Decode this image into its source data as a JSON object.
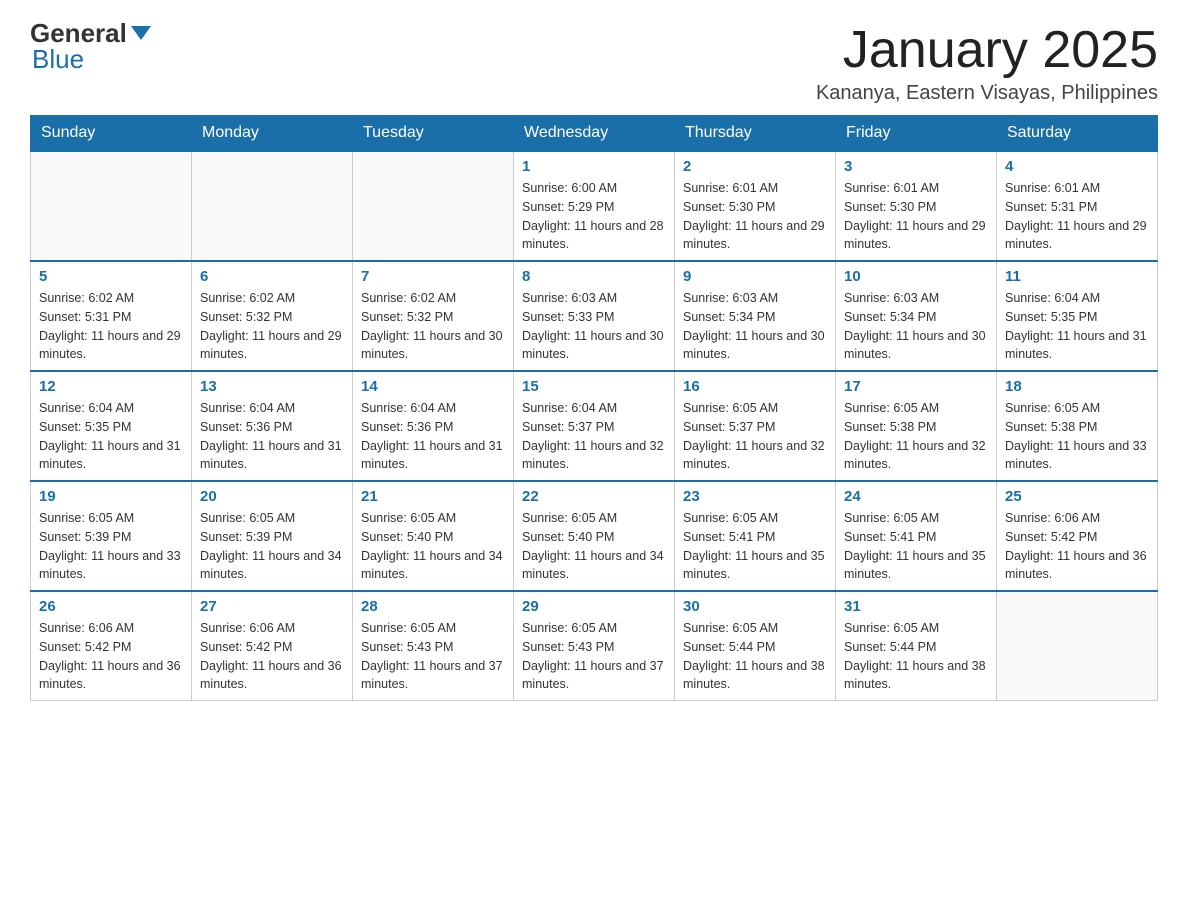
{
  "header": {
    "logo": {
      "general": "General",
      "blue": "Blue"
    },
    "title": "January 2025",
    "location": "Kananya, Eastern Visayas, Philippines"
  },
  "days_of_week": [
    "Sunday",
    "Monday",
    "Tuesday",
    "Wednesday",
    "Thursday",
    "Friday",
    "Saturday"
  ],
  "weeks": [
    [
      {
        "day": "",
        "info": ""
      },
      {
        "day": "",
        "info": ""
      },
      {
        "day": "",
        "info": ""
      },
      {
        "day": "1",
        "info": "Sunrise: 6:00 AM\nSunset: 5:29 PM\nDaylight: 11 hours and 28 minutes."
      },
      {
        "day": "2",
        "info": "Sunrise: 6:01 AM\nSunset: 5:30 PM\nDaylight: 11 hours and 29 minutes."
      },
      {
        "day": "3",
        "info": "Sunrise: 6:01 AM\nSunset: 5:30 PM\nDaylight: 11 hours and 29 minutes."
      },
      {
        "day": "4",
        "info": "Sunrise: 6:01 AM\nSunset: 5:31 PM\nDaylight: 11 hours and 29 minutes."
      }
    ],
    [
      {
        "day": "5",
        "info": "Sunrise: 6:02 AM\nSunset: 5:31 PM\nDaylight: 11 hours and 29 minutes."
      },
      {
        "day": "6",
        "info": "Sunrise: 6:02 AM\nSunset: 5:32 PM\nDaylight: 11 hours and 29 minutes."
      },
      {
        "day": "7",
        "info": "Sunrise: 6:02 AM\nSunset: 5:32 PM\nDaylight: 11 hours and 30 minutes."
      },
      {
        "day": "8",
        "info": "Sunrise: 6:03 AM\nSunset: 5:33 PM\nDaylight: 11 hours and 30 minutes."
      },
      {
        "day": "9",
        "info": "Sunrise: 6:03 AM\nSunset: 5:34 PM\nDaylight: 11 hours and 30 minutes."
      },
      {
        "day": "10",
        "info": "Sunrise: 6:03 AM\nSunset: 5:34 PM\nDaylight: 11 hours and 30 minutes."
      },
      {
        "day": "11",
        "info": "Sunrise: 6:04 AM\nSunset: 5:35 PM\nDaylight: 11 hours and 31 minutes."
      }
    ],
    [
      {
        "day": "12",
        "info": "Sunrise: 6:04 AM\nSunset: 5:35 PM\nDaylight: 11 hours and 31 minutes."
      },
      {
        "day": "13",
        "info": "Sunrise: 6:04 AM\nSunset: 5:36 PM\nDaylight: 11 hours and 31 minutes."
      },
      {
        "day": "14",
        "info": "Sunrise: 6:04 AM\nSunset: 5:36 PM\nDaylight: 11 hours and 31 minutes."
      },
      {
        "day": "15",
        "info": "Sunrise: 6:04 AM\nSunset: 5:37 PM\nDaylight: 11 hours and 32 minutes."
      },
      {
        "day": "16",
        "info": "Sunrise: 6:05 AM\nSunset: 5:37 PM\nDaylight: 11 hours and 32 minutes."
      },
      {
        "day": "17",
        "info": "Sunrise: 6:05 AM\nSunset: 5:38 PM\nDaylight: 11 hours and 32 minutes."
      },
      {
        "day": "18",
        "info": "Sunrise: 6:05 AM\nSunset: 5:38 PM\nDaylight: 11 hours and 33 minutes."
      }
    ],
    [
      {
        "day": "19",
        "info": "Sunrise: 6:05 AM\nSunset: 5:39 PM\nDaylight: 11 hours and 33 minutes."
      },
      {
        "day": "20",
        "info": "Sunrise: 6:05 AM\nSunset: 5:39 PM\nDaylight: 11 hours and 34 minutes."
      },
      {
        "day": "21",
        "info": "Sunrise: 6:05 AM\nSunset: 5:40 PM\nDaylight: 11 hours and 34 minutes."
      },
      {
        "day": "22",
        "info": "Sunrise: 6:05 AM\nSunset: 5:40 PM\nDaylight: 11 hours and 34 minutes."
      },
      {
        "day": "23",
        "info": "Sunrise: 6:05 AM\nSunset: 5:41 PM\nDaylight: 11 hours and 35 minutes."
      },
      {
        "day": "24",
        "info": "Sunrise: 6:05 AM\nSunset: 5:41 PM\nDaylight: 11 hours and 35 minutes."
      },
      {
        "day": "25",
        "info": "Sunrise: 6:06 AM\nSunset: 5:42 PM\nDaylight: 11 hours and 36 minutes."
      }
    ],
    [
      {
        "day": "26",
        "info": "Sunrise: 6:06 AM\nSunset: 5:42 PM\nDaylight: 11 hours and 36 minutes."
      },
      {
        "day": "27",
        "info": "Sunrise: 6:06 AM\nSunset: 5:42 PM\nDaylight: 11 hours and 36 minutes."
      },
      {
        "day": "28",
        "info": "Sunrise: 6:05 AM\nSunset: 5:43 PM\nDaylight: 11 hours and 37 minutes."
      },
      {
        "day": "29",
        "info": "Sunrise: 6:05 AM\nSunset: 5:43 PM\nDaylight: 11 hours and 37 minutes."
      },
      {
        "day": "30",
        "info": "Sunrise: 6:05 AM\nSunset: 5:44 PM\nDaylight: 11 hours and 38 minutes."
      },
      {
        "day": "31",
        "info": "Sunrise: 6:05 AM\nSunset: 5:44 PM\nDaylight: 11 hours and 38 minutes."
      },
      {
        "day": "",
        "info": ""
      }
    ]
  ]
}
